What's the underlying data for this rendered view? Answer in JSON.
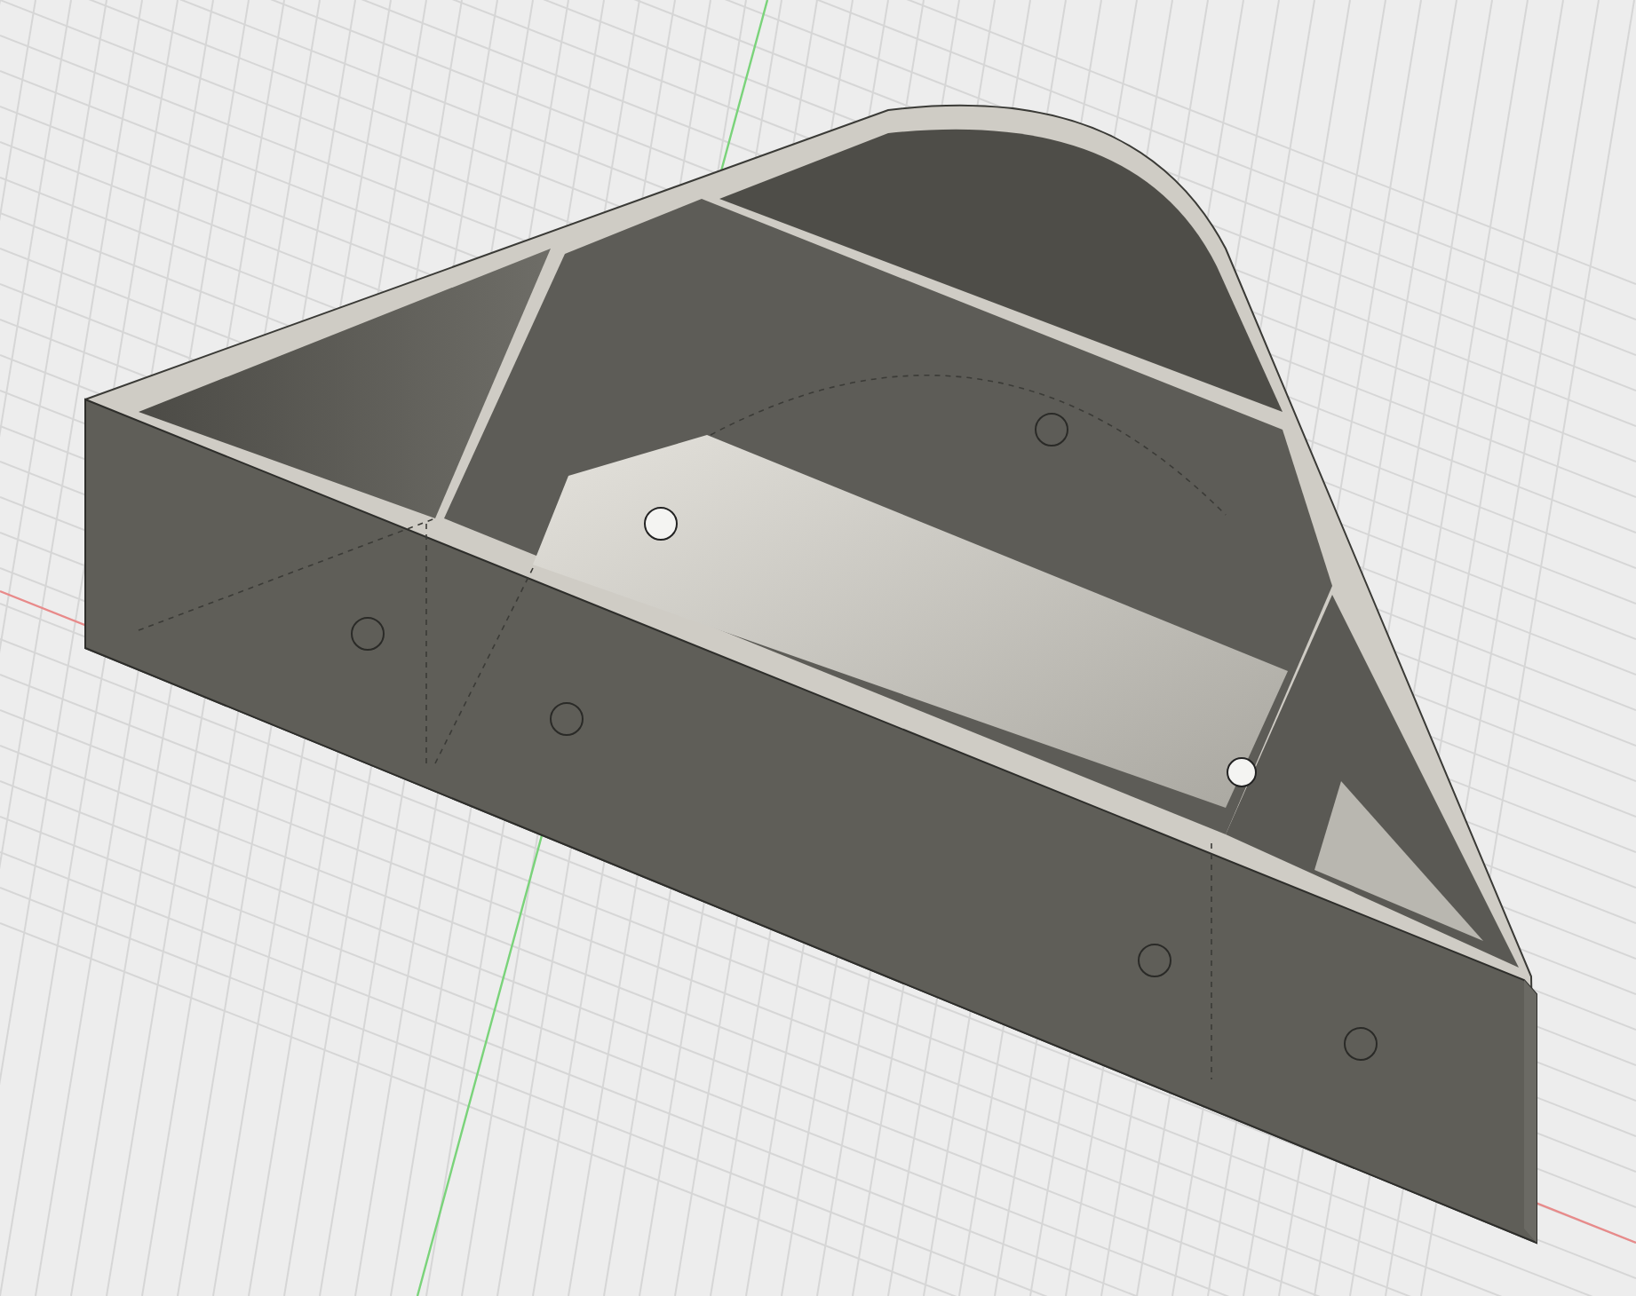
{
  "viewport": {
    "kind": "model-view"
  }
}
